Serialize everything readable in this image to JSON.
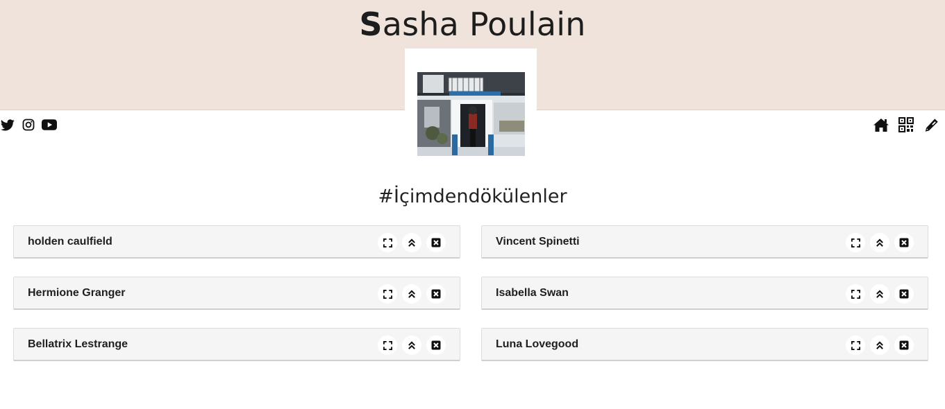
{
  "header": {
    "title_first": "S",
    "title_rest": "asha Poulain",
    "background_color": "#efe3db"
  },
  "social_links": [
    {
      "icon": "twitter-icon"
    },
    {
      "icon": "instagram-icon"
    },
    {
      "icon": "youtube-icon"
    }
  ],
  "toolbar": [
    {
      "icon": "home-icon"
    },
    {
      "icon": "qr-code-icon"
    },
    {
      "icon": "pencil-icon"
    }
  ],
  "section": {
    "title": "#İçimdendökülenler"
  },
  "cards": [
    {
      "title": "holden caulfield"
    },
    {
      "title": "Vincent Spinetti"
    },
    {
      "title": "Hermione Granger"
    },
    {
      "title": "Isabella Swan"
    },
    {
      "title": "Bellatrix Lestrange"
    },
    {
      "title": "Luna Lovegood"
    }
  ],
  "card_actions": [
    "expand-icon",
    "collapse-icon",
    "close-icon"
  ]
}
